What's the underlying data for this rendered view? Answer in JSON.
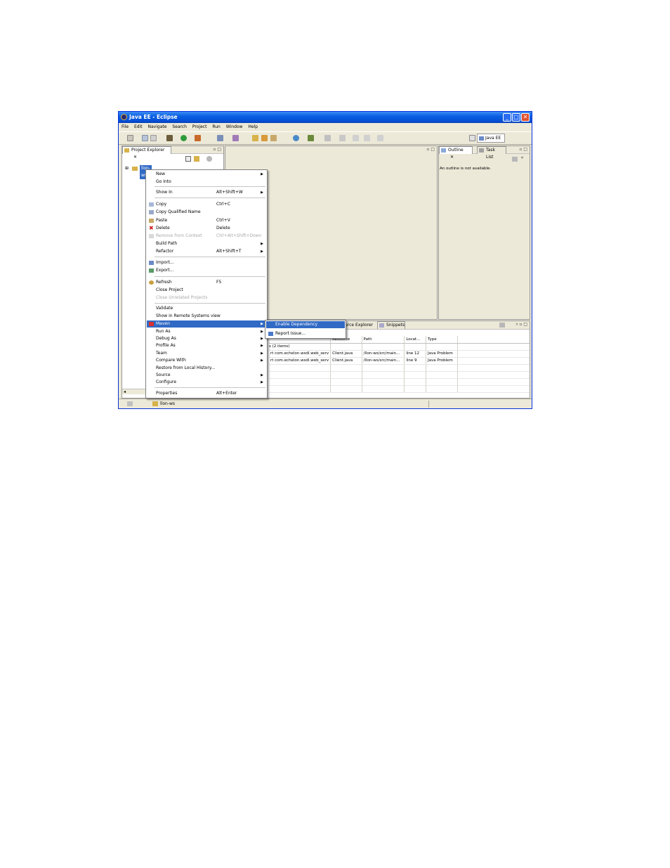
{
  "window": {
    "title": "Java EE - Eclipse",
    "minimize": "_",
    "maximize": "□",
    "close": "✕"
  },
  "menubar": [
    "File",
    "Edit",
    "Navigate",
    "Search",
    "Project",
    "Run",
    "Window",
    "Help"
  ],
  "perspective": {
    "label": "Java EE"
  },
  "project_explorer": {
    "tab_label": "Project Explorer",
    "tab_close": "✕",
    "tree_item": "llon-ws",
    "tree_expander": "⊞",
    "controls": "▫ □"
  },
  "editor_controls": "▫ □",
  "outline": {
    "tab_label": "Outline",
    "tab_close": "✕",
    "tasklist_label": "Task List",
    "message": "An outline is not available.",
    "controls": "▫ □"
  },
  "context_menu": {
    "items": [
      {
        "label": "New",
        "accel": "",
        "submenu": true,
        "disabled": false
      },
      {
        "label": "Go Into",
        "accel": "",
        "submenu": false,
        "disabled": false
      },
      {
        "label": "Show In",
        "accel": "Alt+Shift+W",
        "submenu": true,
        "disabled": false
      },
      {
        "label": "Copy",
        "accel": "Ctrl+C",
        "submenu": false,
        "disabled": false
      },
      {
        "label": "Copy Qualified Name",
        "accel": "",
        "submenu": false,
        "disabled": false
      },
      {
        "label": "Paste",
        "accel": "Ctrl+V",
        "submenu": false,
        "disabled": false
      },
      {
        "label": "Delete",
        "accel": "Delete",
        "submenu": false,
        "disabled": false
      },
      {
        "label": "Remove from Context",
        "accel": "Ctrl+Alt+Shift+Down",
        "submenu": false,
        "disabled": true
      },
      {
        "label": "Build Path",
        "accel": "",
        "submenu": true,
        "disabled": false
      },
      {
        "label": "Refactor",
        "accel": "Alt+Shift+T",
        "submenu": true,
        "disabled": false
      },
      {
        "label": "Import...",
        "accel": "",
        "submenu": false,
        "disabled": false
      },
      {
        "label": "Export...",
        "accel": "",
        "submenu": false,
        "disabled": false
      },
      {
        "label": "Refresh",
        "accel": "F5",
        "submenu": false,
        "disabled": false
      },
      {
        "label": "Close Project",
        "accel": "",
        "submenu": false,
        "disabled": false
      },
      {
        "label": "Close Unrelated Projects",
        "accel": "",
        "submenu": false,
        "disabled": true
      },
      {
        "label": "Validate",
        "accel": "",
        "submenu": false,
        "disabled": false
      },
      {
        "label": "Show in Remote Systems view",
        "accel": "",
        "submenu": false,
        "disabled": false
      },
      {
        "label": "Maven",
        "accel": "",
        "submenu": true,
        "disabled": false
      },
      {
        "label": "Run As",
        "accel": "",
        "submenu": true,
        "disabled": false
      },
      {
        "label": "Debug As",
        "accel": "",
        "submenu": true,
        "disabled": false
      },
      {
        "label": "Profile As",
        "accel": "",
        "submenu": true,
        "disabled": false
      },
      {
        "label": "Team",
        "accel": "",
        "submenu": true,
        "disabled": false
      },
      {
        "label": "Compare With",
        "accel": "",
        "submenu": true,
        "disabled": false
      },
      {
        "label": "Restore from Local History...",
        "accel": "",
        "submenu": false,
        "disabled": false
      },
      {
        "label": "Source",
        "accel": "",
        "submenu": true,
        "disabled": false
      },
      {
        "label": "Configure",
        "accel": "",
        "submenu": true,
        "disabled": false
      },
      {
        "label": "Properties",
        "accel": "Alt+Enter",
        "submenu": false,
        "disabled": false
      }
    ]
  },
  "maven_submenu": {
    "items": [
      "Enable Dependency Management",
      "Report Issue..."
    ]
  },
  "bottom_panel": {
    "tabs": [
      "urce Explorer",
      "Snippets"
    ],
    "summary": "s (2 items)",
    "columns": [
      "Resource",
      "Path",
      "Locat...",
      "Type"
    ],
    "rows": [
      [
        "rt com.echelon.wsdl.web_serv",
        "Client.java",
        "/llon-ws/src/main...",
        "line 12",
        "Java Problem"
      ],
      [
        "rt com.echelon.wsdl.web_serv",
        "Client.java",
        "/llon-ws/src/main...",
        "line 9",
        "Java Problem"
      ]
    ]
  },
  "statusbar": {
    "text": "llon-ws"
  },
  "colors": {
    "selection": "#316ac5",
    "titlebar": "#0a5fe0",
    "chrome": "#ece9d8"
  }
}
